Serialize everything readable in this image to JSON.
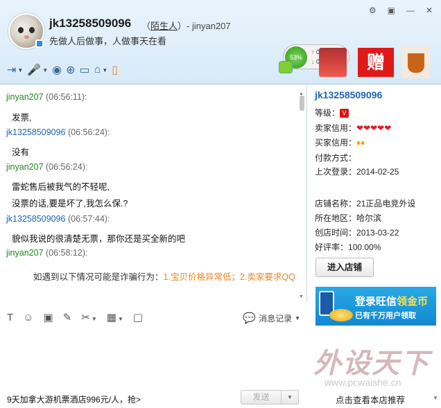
{
  "header": {
    "username": "jk13258509096",
    "relation_open": "（",
    "relation": "陌生人",
    "relation_close": "）- jinyan207",
    "signature": "先做人后做事，人做事天在看",
    "speed_percent": "53%",
    "upload_speed": "0K/s",
    "download_speed": "0K/s",
    "ad_text": "赠",
    "window_buttons": [
      "⚙",
      "▣",
      "—",
      "✕"
    ]
  },
  "chat": {
    "messages": [
      {
        "sender": "jinyan207",
        "time": "(06:56:11):",
        "lines": [
          "发票,"
        ]
      },
      {
        "sender": "jk13258509096",
        "time": "(06:56:24):",
        "lines": [
          "没有"
        ]
      },
      {
        "sender": "jinyan207",
        "time": "(06:56:24):",
        "lines": [
          "雷蛇售后被我气的不轻呢,",
          "没票的话,要是坏了,我怎么保.?"
        ]
      },
      {
        "sender": "jk13258509096",
        "time": "(06:57:44):",
        "lines": [
          "貌似我说的很清楚无票，那你还是买全新的吧"
        ]
      },
      {
        "sender": "jinyan207",
        "time": "(06:58:12):",
        "lines": []
      }
    ],
    "warning_prefix": "如遇到以下情况可能是诈骗行为：",
    "warning_highlight": "1.宝贝价格异常低；2.卖家要求QQ"
  },
  "input": {
    "history_label": "消息记录",
    "promo_text": "9天加拿大游机票酒店996元/人，抢>",
    "send_label": "发送"
  },
  "shop": {
    "name": "jk13258509096",
    "level_label": "等级：",
    "seller_credit_label": "卖家信用：",
    "buyer_credit_label": "买家信用：",
    "payment_label": "付款方式：",
    "last_login_label": "上次登录：",
    "last_login": "2014-02-25",
    "store_name_label": "店铺名称：",
    "store_name": "21正品电竞外设",
    "region_label": "所在地区：",
    "region": "哈尔滨",
    "created_label": "创店时间：",
    "created": "2013-03-22",
    "rating_label": "好评率：",
    "rating": "100.00%",
    "enter_button": "进入店铺",
    "banner_title_a": "登录旺信",
    "banner_title_b": "领金币",
    "banner_sub": "已有千万用户领取",
    "recommend": "点击查看本店推荐",
    "watermark": "外设天下",
    "watermark_url": "www.pcwaishe.cn"
  },
  "colors": {
    "sender_other": "#1d8a1d",
    "sender_self": "#1b63b8",
    "warning": "#e8862a",
    "header_bg": "#e9f4fc"
  }
}
